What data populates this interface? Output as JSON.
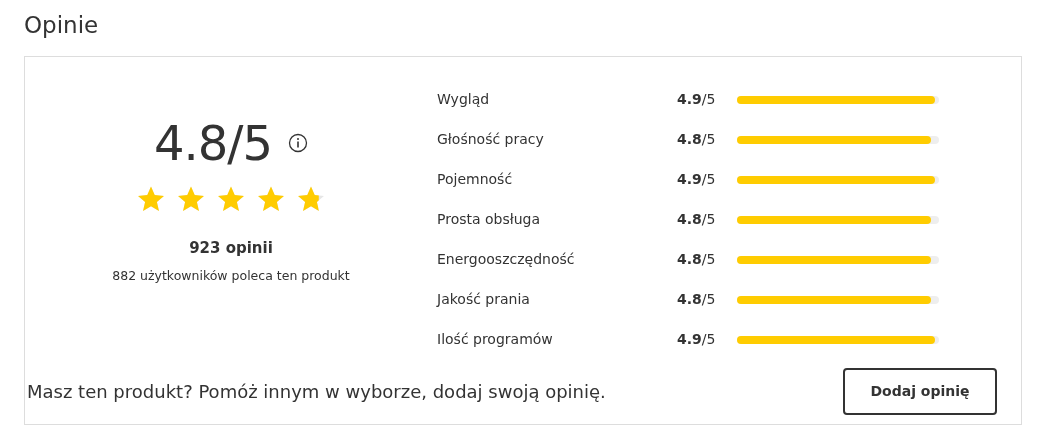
{
  "heading": "Opinie",
  "summary": {
    "score": "4.8/5",
    "stars": 4.8,
    "count": "923 opinii",
    "recommend": "882 użytkowników poleca ten produkt"
  },
  "criteria": [
    {
      "label": "Wygląd",
      "reading": "**4.9**/5",
      "level": 0.98
    },
    {
      "label": "Głośność pracy",
      "reading": "**4.8**/5",
      "level": 0.96
    },
    {
      "label": "Pojemność",
      "reading": "**4.9**/5",
      "level": 0.98
    },
    {
      "label": "Prosta obsługa",
      "reading": "**4.8**/5",
      "level": 0.96
    },
    {
      "label": "Energooszczędność",
      "reading": "**4.8**/5",
      "level": 0.96
    },
    {
      "label": "Jakość prania",
      "reading": "**4.8**/5",
      "level": 0.96
    },
    {
      "label": "Ilość programów",
      "reading": "**4.9**/5",
      "level": 0.98
    }
  ],
  "footer": {
    "prompt": "Masz ten produkt? Pomóż innym w wyborze, dodaj swoją opinię.",
    "button": "Dodaj opinię"
  }
}
